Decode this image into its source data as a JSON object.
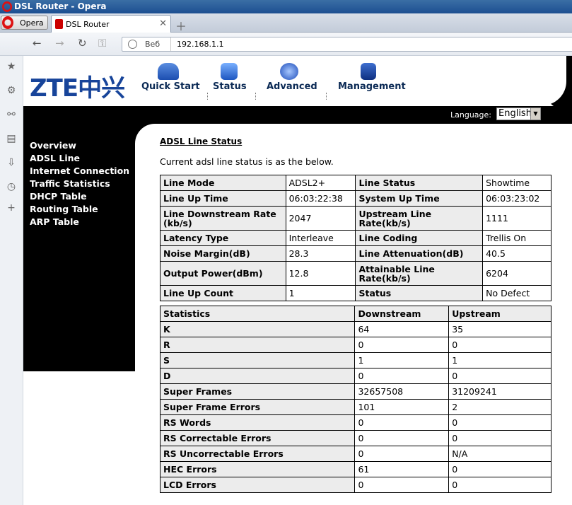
{
  "window": {
    "title": "DSL Router - Opera"
  },
  "tabs": {
    "opera_label": "Opera",
    "active_tab": "DSL Router"
  },
  "address": {
    "scheme": "Веб",
    "url": "192.168.1.1"
  },
  "header": {
    "logo": "ZTE中兴",
    "nav": [
      {
        "label": "Quick Start",
        "icon": "quick-start-icon"
      },
      {
        "label": "Status",
        "icon": "status-icon"
      },
      {
        "label": "Advanced",
        "icon": "advanced-icon"
      },
      {
        "label": "Management",
        "icon": "management-icon"
      }
    ],
    "language_label": "Language:",
    "language_value": "English"
  },
  "menu": [
    "Overview",
    "ADSL Line",
    "Internet Connection",
    "Traffic Statistics",
    "DHCP Table",
    "Routing Table",
    "ARP Table"
  ],
  "main": {
    "title": "ADSL Line Status",
    "intro": "Current adsl line status is as the below.",
    "status_rows": [
      [
        "Line Mode",
        "ADSL2+",
        "Line Status",
        "Showtime"
      ],
      [
        "Line Up Time",
        "06:03:22:38",
        "System Up Time",
        "06:03:23:02"
      ],
      [
        "Line Downstream Rate (kb/s)",
        "2047",
        "Upstream Line Rate(kb/s)",
        "1111"
      ],
      [
        "Latency Type",
        "Interleave",
        "Line Coding",
        "Trellis On"
      ],
      [
        "Noise Margin(dB)",
        "28.3",
        "Line Attenuation(dB)",
        "40.5"
      ],
      [
        "Output Power(dBm)",
        "12.8",
        "Attainable Line Rate(kb/s)",
        "6204"
      ],
      [
        "Line Up Count",
        "1",
        "Status",
        "No Defect"
      ]
    ],
    "stats_header": [
      "Statistics",
      "Downstream",
      "Upstream"
    ],
    "stats_rows": [
      [
        "K",
        "64",
        "35"
      ],
      [
        "R",
        "0",
        "0"
      ],
      [
        "S",
        "1",
        "1"
      ],
      [
        "D",
        "0",
        "0"
      ],
      [
        "Super Frames",
        "32657508",
        "31209241"
      ],
      [
        "Super Frame Errors",
        "101",
        "2"
      ],
      [
        "RS Words",
        "0",
        "0"
      ],
      [
        "RS Correctable Errors",
        "0",
        "0"
      ],
      [
        "RS Uncorrectable Errors",
        "0",
        "N/A"
      ],
      [
        "HEC Errors",
        "61",
        "0"
      ],
      [
        "LCD Errors",
        "0",
        "0"
      ]
    ]
  }
}
